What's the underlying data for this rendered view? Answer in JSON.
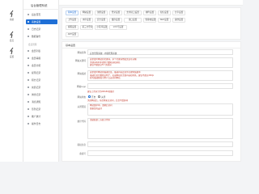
{
  "sidebar": {
    "brand": "后台管理系统",
    "items": [
      {
        "label": "后台首页",
        "active": false
      },
      {
        "label": "系统设置",
        "active": true
      },
      {
        "label": "日志记录",
        "active": false
      },
      {
        "label": "数据备份",
        "active": false
      }
    ],
    "group_label": "会员管理",
    "items2": [
      {
        "label": "会员列表"
      },
      {
        "label": "会员等级"
      },
      {
        "label": "会员分组"
      },
      {
        "label": "提现记录"
      },
      {
        "label": "积分记录"
      },
      {
        "label": "充值记录"
      },
      {
        "label": "佣金记录"
      },
      {
        "label": "消息通知"
      },
      {
        "label": "签到记录"
      },
      {
        "label": "推广统计"
      },
      {
        "label": "操作日志"
      }
    ]
  },
  "rail": [
    {
      "label": "系统",
      "icon": "system-icon"
    },
    {
      "label": "会员",
      "icon": "member-icon"
    },
    {
      "label": "设置",
      "icon": "settings-icon"
    }
  ],
  "tabs": [
    "基本设置",
    "网站设置",
    "注册设置",
    "登录设置",
    "支付接口设置",
    "邮件设置",
    "短信设置",
    "分享设置",
    "上传设置",
    "水印设置",
    "安全设置",
    "缓存设置",
    "接口设置",
    "伪静态设置",
    "SEO设置",
    "其他设置",
    "客服设置",
    "第三方登录",
    "小程序设置",
    "公众号设置",
    "APP设置"
  ],
  "panel": {
    "title": "基本设置",
    "fields": [
      {
        "label": "网站名称",
        "value": "后台管理系统 - 内容管理系统"
      },
      {
        "label": "网站关键词",
        "lines": [
          "这里填写网站的关键词，多个关键词用英文逗号分隔",
          "关键词有利于搜索引擎收录和排名",
          "建议不要超过5个关键词"
        ]
      },
      {
        "label": "网站描述",
        "lines": [
          "这里填写网站的描述信息，描述内容会显示在搜索结果中",
          "描述信息尽量简洁明了，突出网站的主要内容和特色，建议不超过200字",
          "好的描述能吸引用户点击访问网站"
        ]
      },
      {
        "label": "网站Logo",
        "value": ""
      },
      {
        "label": "网站状态",
        "value": ""
      },
      {
        "label": "关闭原因",
        "lines": [
          "网站维护中，请稍后访问",
          "感谢您的支持"
        ]
      },
      {
        "label": "统计代码",
        "lines": [
          "请粘贴第三方统计代码"
        ]
      },
      {
        "label": "版权信息",
        "value": ""
      },
      {
        "label": "备案号",
        "value": ""
      }
    ],
    "logo_hint": "建议上传尺寸为200x60的图片",
    "status_options": [
      "开启",
      "关闭"
    ],
    "status_hint": "关闭网站后，前台将无法访问，后台不受影响"
  },
  "colors": {
    "accent": "#1f6fd6",
    "warn": "#c0392b"
  }
}
